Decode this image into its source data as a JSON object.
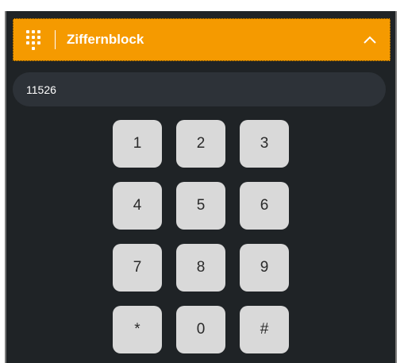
{
  "header": {
    "title": "Ziffernblock",
    "icon": "dialpad-icon",
    "collapse_icon": "chevron-up-icon",
    "accent_color": "#f59a00"
  },
  "display": {
    "value": "11526"
  },
  "keypad": {
    "keys": [
      "1",
      "2",
      "3",
      "4",
      "5",
      "6",
      "7",
      "8",
      "9",
      "*",
      "0",
      "#"
    ]
  },
  "colors": {
    "panel_background": "#1f2326",
    "display_background": "#2d3238",
    "key_background": "#d9d9d9"
  }
}
